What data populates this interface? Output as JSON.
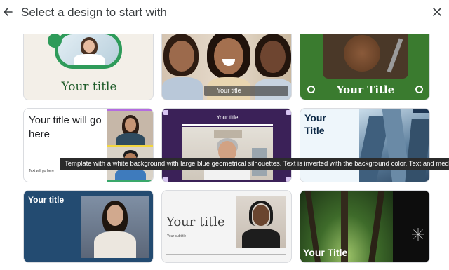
{
  "header": {
    "title": "Select a design to start with",
    "back_icon": "arrow-back-icon",
    "close_icon": "close-icon"
  },
  "templates": [
    {
      "title": "Your title",
      "style": "cream-green-speaker"
    },
    {
      "title": "Your title",
      "style": "photo-group-laughing"
    },
    {
      "title": "Your Title",
      "style": "green-wood-table"
    },
    {
      "title": "Your title will go here",
      "caption": "Text will go here",
      "style": "white-video-grid"
    },
    {
      "title": "Your title",
      "style": "purple-video-call"
    },
    {
      "title": "Your Title",
      "style": "light-blue-buildings"
    },
    {
      "title": "Your title",
      "style": "navy-speaker"
    },
    {
      "title": "Your title",
      "subtitle": "Your subtitle",
      "style": "gray-serif-speaker"
    },
    {
      "title": "Your Title",
      "style": "black-forest"
    }
  ],
  "tooltip": "Template with a white background with large blue geometrical silhouettes. Text is inverted with the background color. Text and media appear on l",
  "colors": {
    "accent_green": "#3a7b2f",
    "title_green": "#1f5c2a",
    "purple": "#3b2158",
    "navy": "#234b71",
    "dark_navy": "#0e2a47"
  }
}
